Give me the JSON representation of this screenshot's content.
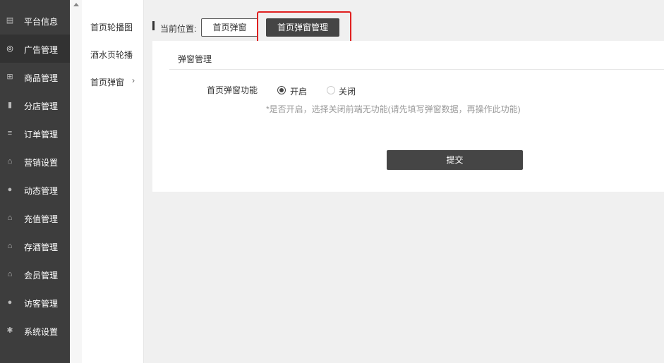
{
  "sidebar": {
    "items": [
      {
        "label": "平台信息",
        "icon": "newspaper-icon",
        "glyph": "▤",
        "active": false
      },
      {
        "label": "广告管理",
        "icon": "support-icon",
        "glyph": "◎",
        "active": true
      },
      {
        "label": "商品管理",
        "icon": "cart-icon",
        "glyph": "⊞",
        "active": false
      },
      {
        "label": "分店管理",
        "icon": "book-icon",
        "glyph": "▮",
        "active": false
      },
      {
        "label": "订单管理",
        "icon": "list-icon",
        "glyph": "≡",
        "active": false
      },
      {
        "label": "营销设置",
        "icon": "gift-icon",
        "glyph": "⌂",
        "active": false
      },
      {
        "label": "动态管理",
        "icon": "user-icon",
        "glyph": "●",
        "active": false
      },
      {
        "label": "充值管理",
        "icon": "gift-icon",
        "glyph": "⌂",
        "active": false
      },
      {
        "label": "存酒管理",
        "icon": "gift-icon",
        "glyph": "⌂",
        "active": false
      },
      {
        "label": "会员管理",
        "icon": "gift-icon",
        "glyph": "⌂",
        "active": false
      },
      {
        "label": "访客管理",
        "icon": "user-icon",
        "glyph": "●",
        "active": false
      },
      {
        "label": "系统设置",
        "icon": "gear-icon",
        "glyph": "✱",
        "active": false
      }
    ]
  },
  "subnav": {
    "items": [
      "首页轮播图",
      "酒水页轮播",
      "首页弹窗"
    ],
    "chevron": "›"
  },
  "breadcrumb": {
    "label": "当前位置:",
    "level1": "首页弹窗",
    "level2": "首页弹窗管理"
  },
  "panel": {
    "title": "弹窗管理",
    "field_label": "首页弹窗功能",
    "option_on": "开启",
    "option_off": "关闭",
    "selected": "开启",
    "hint": "*是否开启，选择关闭前端无功能(请先填写弹窗数据，再操作此功能)",
    "submit_label": "提交"
  },
  "colors": {
    "sidebar_bg": "#3d3d3d",
    "highlight_border": "#e02020",
    "button_dark": "#454545"
  }
}
